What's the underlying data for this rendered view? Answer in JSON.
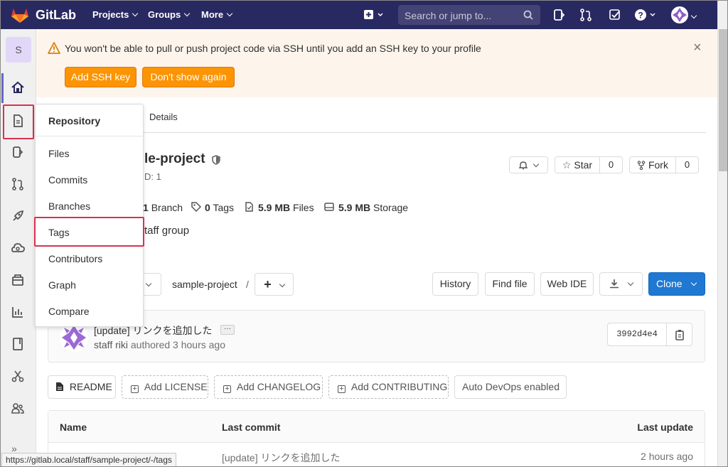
{
  "header": {
    "brand": "GitLab",
    "nav": [
      "Projects",
      "Groups",
      "More"
    ],
    "search_placeholder": "Search or jump to...",
    "colors": {
      "bar": "#292961",
      "accent": "#fc9403",
      "primary": "#1f78d1"
    }
  },
  "sidebar": {
    "project_letter": "S",
    "expand_symbol": "»",
    "icons": [
      "home-icon",
      "repository-icon",
      "issues-icon",
      "merge-requests-icon",
      "ci-cd-icon",
      "operations-icon",
      "packages-icon",
      "analytics-icon",
      "wiki-icon",
      "snippets-icon",
      "members-icon"
    ]
  },
  "alert": {
    "message": "You won't be able to pull or push project code via SSH until you add an SSH key to your profile",
    "add_key": "Add SSH key",
    "dont_show": "Don't show again"
  },
  "tabs": {
    "details": "Details"
  },
  "project": {
    "title_visible": "le-project",
    "id_visible": "D: 1",
    "branches": {
      "count": "1",
      "label": "Branch"
    },
    "tags": {
      "count": "0",
      "label": "Tags"
    },
    "files": {
      "size": "5.9 MB",
      "label": "Files"
    },
    "storage": {
      "size": "5.9 MB",
      "label": "Storage"
    },
    "description_visible": "taff group",
    "star_label": "Star",
    "star_count": "0",
    "fork_label": "Fork",
    "fork_count": "0"
  },
  "toolbar": {
    "path": "sample-project",
    "separator": "/",
    "history": "History",
    "find_file": "Find file",
    "web_ide": "Web IDE",
    "clone": "Clone"
  },
  "commit": {
    "message": "[update] リンクを追加した",
    "ellipsis": "···",
    "author": "staff riki",
    "meta": "authored 3 hours ago",
    "sha": "3992d4e4"
  },
  "quick": {
    "readme": "README",
    "license": "Add LICENSE",
    "changelog": "Add CHANGELOG",
    "contributing": "Add CONTRIBUTING",
    "autodevops": "Auto DevOps enabled"
  },
  "files_table": {
    "headers": [
      "Name",
      "Last commit",
      "Last update"
    ],
    "rows": [
      {
        "commit": "[update] リンクを追加した",
        "update": "2 hours ago"
      }
    ]
  },
  "dropdown": {
    "title": "Repository",
    "items": [
      "Files",
      "Commits",
      "Branches",
      "Tags",
      "Contributors",
      "Graph",
      "Compare"
    ]
  },
  "statusbar": "https://gitlab.local/staff/sample-project/-/tags"
}
